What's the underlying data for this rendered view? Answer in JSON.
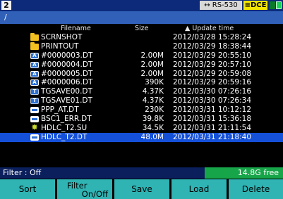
{
  "topbar": {
    "window_number": "2",
    "rs_label": "RS-530",
    "dce_label": "DCE"
  },
  "path": "/",
  "columns": {
    "filename": "Filename",
    "size": "Size",
    "update_time": "▲ Update time"
  },
  "files": [
    {
      "icon": "folder-icon",
      "name": "SCRNSHOT",
      "size": "",
      "time": "2012/03/28 15:28:24",
      "selected": false
    },
    {
      "icon": "folder-icon",
      "name": "PRINTOUT",
      "size": "",
      "time": "2012/03/29 18:38:44",
      "selected": false
    },
    {
      "icon": "a-file-icon",
      "name": "#0000003.DT",
      "size": "2.00M",
      "time": "2012/03/29 20:55:10",
      "selected": false
    },
    {
      "icon": "a-file-icon",
      "name": "#0000004.DT",
      "size": "2.00M",
      "time": "2012/03/29 20:57:10",
      "selected": false
    },
    {
      "icon": "a-file-icon",
      "name": "#0000005.DT",
      "size": "2.00M",
      "time": "2012/03/29 20:59:08",
      "selected": false
    },
    {
      "icon": "a-file-icon",
      "name": "#0000006.DT",
      "size": "390K",
      "time": "2012/03/29 20:59:16",
      "selected": false
    },
    {
      "icon": "t-file-icon",
      "name": "TGSAVE00.DT",
      "size": "4.37K",
      "time": "2012/03/30 07:26:16",
      "selected": false
    },
    {
      "icon": "t-file-icon",
      "name": "TGSAVE01.DT",
      "size": "4.37K",
      "time": "2012/03/30 07:26:34",
      "selected": false
    },
    {
      "icon": "doc-icon",
      "name": "PPP_AT.DT",
      "size": "230K",
      "time": "2012/03/31 10:12:12",
      "selected": false
    },
    {
      "icon": "doc-icon",
      "name": "BSC1_ERR.DT",
      "size": "39.8K",
      "time": "2012/03/31 15:36:18",
      "selected": false
    },
    {
      "icon": "star-file-icon",
      "name": "HDLC_T2.SU",
      "size": "34.5K",
      "time": "2012/03/31 21:11:54",
      "selected": false
    },
    {
      "icon": "doc-icon",
      "name": "HDLC_T2.DT",
      "size": "48.0M",
      "time": "2012/03/31 21:18:40",
      "selected": true
    }
  ],
  "status": {
    "filter": "Filter : Off",
    "free": "14.8G free"
  },
  "fkeys": {
    "sort": "Sort",
    "filter_line1": "Filter",
    "filter_line2": "On/Off",
    "save": "Save",
    "load": "Load",
    "delete": "Delete"
  },
  "colors": {
    "accent": "#3060b8",
    "selected_row": "#1450d8",
    "fkey": "#2fb3b3",
    "free_badge": "#17a54a",
    "dce_badge": "#f2e600"
  }
}
